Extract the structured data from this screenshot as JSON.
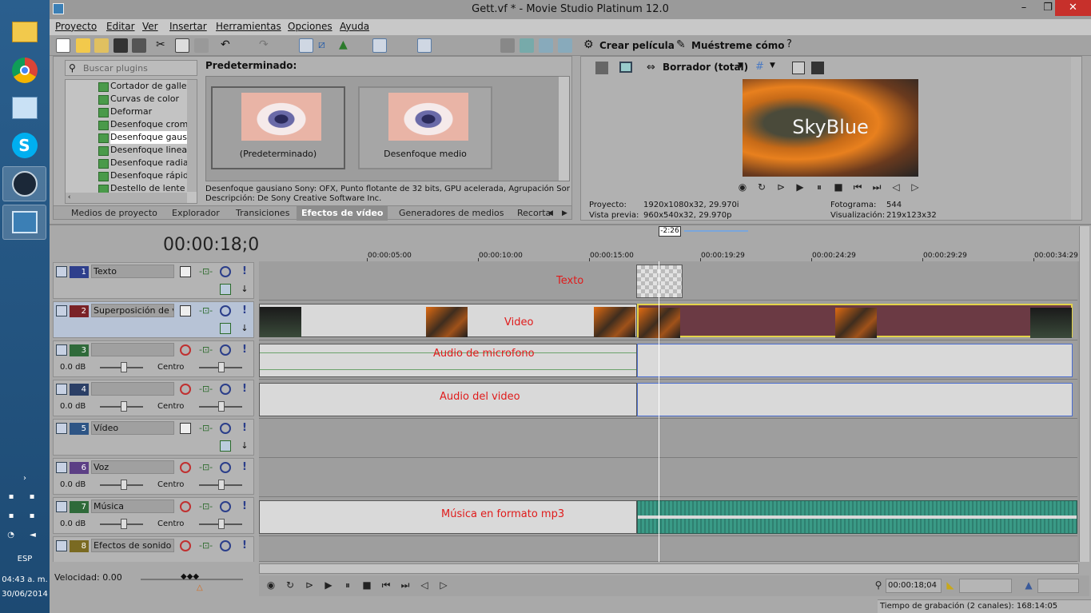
{
  "taskbar": {
    "time": "04:43 a. m.",
    "date": "30/06/2014",
    "lang": "ESP",
    "apps": [
      {
        "icon": "file-explorer-icon"
      },
      {
        "icon": "chrome-icon"
      },
      {
        "icon": "control-panel-icon"
      },
      {
        "icon": "skype-icon"
      },
      {
        "icon": "steam-icon"
      },
      {
        "icon": "movie-studio-icon"
      }
    ]
  },
  "window": {
    "title": "Gett.vf * - Movie Studio Platinum 12.0"
  },
  "menu": {
    "items": [
      "Proyecto",
      "Editar",
      "Ver",
      "Insertar",
      "Herramientas",
      "Opciones",
      "Ayuda"
    ]
  },
  "toolbar": {
    "make_movie": "Crear película",
    "show_me": "Muéstreme cómo"
  },
  "plugins": {
    "search_placeholder": "Buscar plugins",
    "items": [
      "Cortador de gallet",
      "Curvas de color",
      "Deformar",
      "Desenfoque croma",
      "Desenfoque gausia",
      "Desenfoque lineal",
      "Desenfoque radial",
      "Desenfoque rápido",
      "Destello de lente"
    ],
    "selected_index": 4,
    "presets_header": "Predeterminado:",
    "presets": [
      "(Predeterminado)",
      "Desenfoque medio"
    ],
    "info_line1": "Desenfoque gausiano Sony: OFX, Punto flotante de 32 bits, GPU acelerada, Agrupación Sony\\D",
    "info_line2": "Descripción: De Sony Creative Software Inc."
  },
  "tabs": [
    "Medios de proyecto",
    "Explorador",
    "Transiciones",
    "Efectos de vídeo",
    "Generadores de medios",
    "Recorta"
  ],
  "tabs_selected": 3,
  "preview": {
    "mode": "Borrador (total)",
    "overlay_text": "SkyBlue",
    "proyecto_label": "Proyecto:",
    "proyecto_value": "1920x1080x32, 29.970i",
    "vista_label": "Vista previa:",
    "vista_value": "960x540x32, 29.970p",
    "fotograma_label": "Fotograma:",
    "fotograma_value": "544",
    "visual_label": "Visualización:",
    "visual_value": "219x123x32"
  },
  "timeline": {
    "current_time": "00:00:18;04",
    "region_length": "-2:26",
    "ruler": [
      "00:00:05:00",
      "00:00:10:00",
      "00:00:15:00",
      "00:00:19:29",
      "00:00:24:29",
      "00:00:29:29",
      "00:00:34:29"
    ],
    "velocity": "Velocidad: 0.00",
    "bottom_time": "00:00:18;04",
    "record_time": "Tiempo de grabación (2 canales): 168:14:05"
  },
  "tracks": [
    {
      "num": "1",
      "name": "Texto",
      "type": "video",
      "color": "#2e3f8c"
    },
    {
      "num": "2",
      "name": "Superposición de v...",
      "type": "video",
      "color": "#7a2227"
    },
    {
      "num": "3",
      "name": "",
      "type": "audio",
      "color": "#2f6a3a",
      "vol": "0.0 dB",
      "pan": "Centro"
    },
    {
      "num": "4",
      "name": "",
      "type": "audio",
      "color": "#2b3f66",
      "vol": "0.0 dB",
      "pan": "Centro"
    },
    {
      "num": "5",
      "name": "Vídeo",
      "type": "video",
      "color": "#2e5585"
    },
    {
      "num": "6",
      "name": "Voz",
      "type": "audio",
      "color": "#5c3f85",
      "vol": "0.0 dB",
      "pan": "Centro"
    },
    {
      "num": "7",
      "name": "Música",
      "type": "audio",
      "color": "#2f6a3a",
      "vol": "0.0 dB",
      "pan": "Centro"
    },
    {
      "num": "8",
      "name": "Efectos de sonido",
      "type": "audio",
      "color": "#7a6a22"
    }
  ],
  "lane_labels": {
    "texto": "Texto",
    "video": "Video",
    "mic": "Audio de microfono",
    "audio_video": "Audio del video",
    "musica": "Música en formato mp3"
  }
}
